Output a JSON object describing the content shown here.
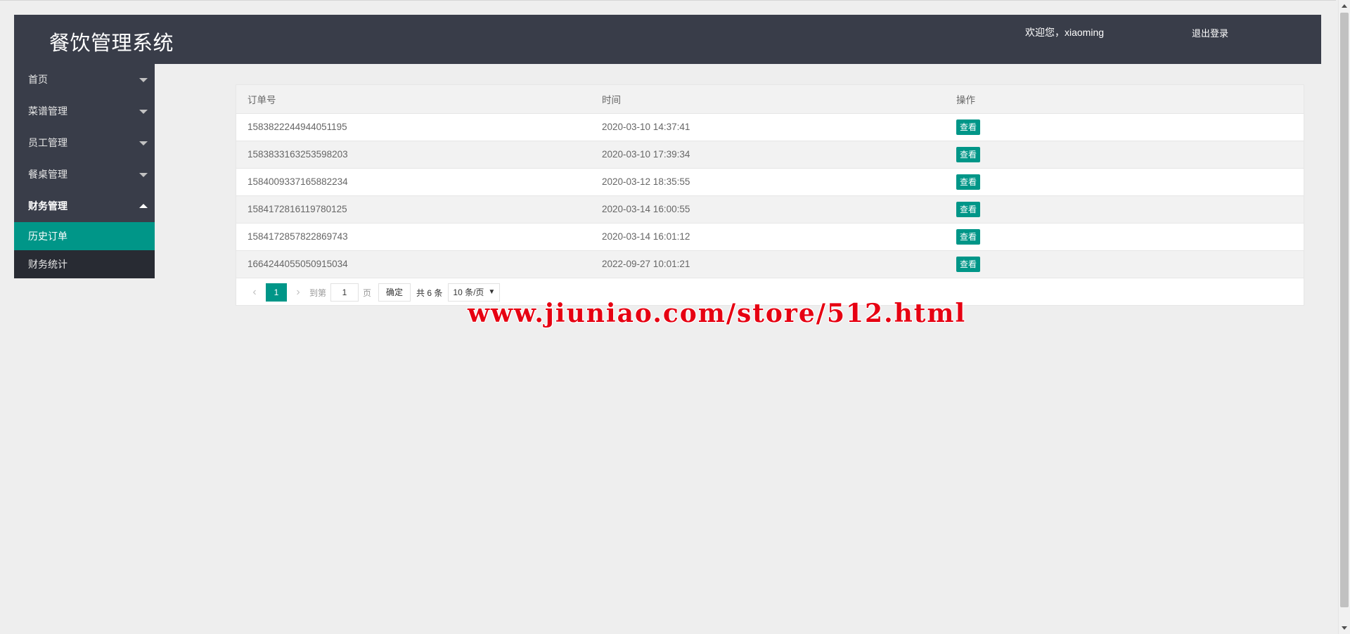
{
  "header": {
    "title": "餐饮管理系统",
    "welcome": "欢迎您，xiaoming",
    "logout": "退出登录"
  },
  "sidebar": {
    "items": [
      {
        "label": "首页"
      },
      {
        "label": "菜谱管理"
      },
      {
        "label": "员工管理"
      },
      {
        "label": "餐桌管理"
      },
      {
        "label": "财务管理"
      }
    ],
    "subitems": [
      {
        "label": "历史订单"
      },
      {
        "label": "财务统计"
      }
    ]
  },
  "table": {
    "columns": [
      "订单号",
      "时间",
      "操作"
    ],
    "action_label": "查看",
    "rows": [
      {
        "order_id": "1583822244944051195",
        "time": "2020-03-10 14:37:41"
      },
      {
        "order_id": "1583833163253598203",
        "time": "2020-03-10 17:39:34"
      },
      {
        "order_id": "1584009337165882234",
        "time": "2020-03-12 18:35:55"
      },
      {
        "order_id": "1584172816119780125",
        "time": "2020-03-14 16:00:55"
      },
      {
        "order_id": "1584172857822869743",
        "time": "2020-03-14 16:01:12"
      },
      {
        "order_id": "1664244055050915034",
        "time": "2022-09-27 10:01:21"
      }
    ]
  },
  "pager": {
    "current": "1",
    "goto_label": "到第",
    "goto_value": "1",
    "page_label": "页",
    "confirm_label": "确定",
    "total_label": "共 6 条",
    "page_size": "10 条/页"
  },
  "watermark": "www.jiuniao.com/store/512.html",
  "colors": {
    "header_bg": "#393d49",
    "accent": "#009688",
    "sub_bg": "#282b33",
    "watermark": "#e60012"
  }
}
